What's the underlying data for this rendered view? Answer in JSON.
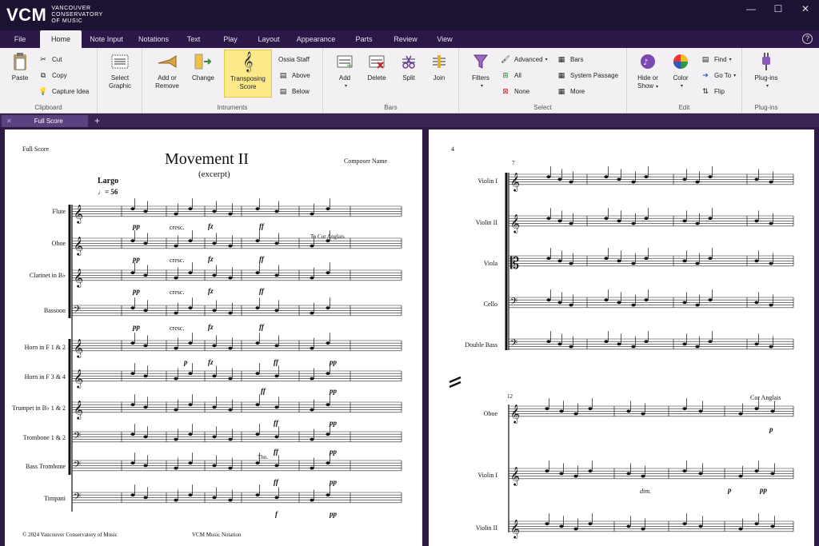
{
  "app": {
    "logo_mark": "VCM",
    "logo_text": "VANCOUVER CONSERVATORY OF MUSIC"
  },
  "window_controls": {
    "minimize": "—",
    "maximize": "☐",
    "close": "✕"
  },
  "menu": {
    "tabs": [
      "File",
      "Home",
      "Note Input",
      "Notations",
      "Text",
      "Play",
      "Layout",
      "Appearance",
      "Parts",
      "Review",
      "View"
    ],
    "active": "Home",
    "help": "?"
  },
  "ribbon": {
    "clipboard": {
      "paste": "Paste",
      "cut": "Cut",
      "copy": "Copy",
      "capture": "Capture Idea",
      "label": "Clipboard"
    },
    "graphic": {
      "select_graphic_1": "Select",
      "select_graphic_2": "Graphic"
    },
    "instruments": {
      "add_remove_1": "Add or",
      "add_remove_2": "Remove",
      "change": "Change",
      "transposing_1": "Transposing",
      "transposing_2": "Score",
      "ossia": "Ossia Staff",
      "above": "Above",
      "below": "Below",
      "label": "Intruments"
    },
    "bars": {
      "add": "Add",
      "delete": "Delete",
      "split": "Split",
      "join": "Join",
      "label": "Bars"
    },
    "select": {
      "filters": "Filters",
      "advanced": "Advanced",
      "all": "All",
      "none": "None",
      "bars": "Bars",
      "system_passage": "System Passage",
      "more": "More",
      "label": "Select"
    },
    "edit": {
      "hide_show_1": "Hide or",
      "hide_show_2": "Show",
      "color": "Color",
      "find": "Find",
      "goto": "Go To",
      "flip": "Flip",
      "label": "Edit"
    },
    "plugins": {
      "plugins": "Plug-ins",
      "label": "Plug-ins"
    }
  },
  "document_tab": {
    "name": "Full Score",
    "add": "+"
  },
  "score": {
    "left_page": {
      "header": "Full Score",
      "title": "Movement II",
      "subtitle": "(excerpt)",
      "composer": "Composer Name",
      "tempo": "Largo",
      "metronome": "♩= 56",
      "instruments": [
        "Flute",
        "Oboe",
        "Clarinet in B♭",
        "Bassoon",
        "Horn in F 1 & 2",
        "Horn in F 3 & 4",
        "Trumpet in B♭ 1 & 2",
        "Trombone 1 & 2",
        "Bass Trombone",
        "Timpani"
      ],
      "to_cor_anglais": "To Cor Anglais",
      "thn": "Thn.",
      "dyn_pp": "pp",
      "dyn_fz": "fz",
      "dyn_ff": "ff",
      "dyn_p": "p",
      "dyn_f": "f",
      "cresc": "cresc.",
      "copyright": "© 2024 Vancouver Conservatory of Music",
      "footer": "VCM Music Notation"
    },
    "right_page": {
      "page_number": "4",
      "bar_7": "7",
      "bar_12": "12",
      "instruments_top": [
        "Violin I",
        "Violin II",
        "Viola",
        "Cello",
        "Double Bass"
      ],
      "instruments_bottom": [
        "Oboe",
        "Violin I",
        "Violin II"
      ],
      "cor_anglais": "Cor Anglais",
      "dim": "dim.",
      "dyn_p": "p",
      "dyn_pp": "pp"
    }
  }
}
